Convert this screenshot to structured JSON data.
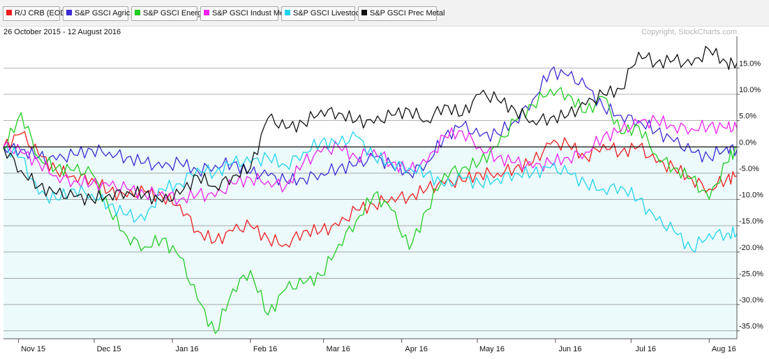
{
  "legend": [
    {
      "label": "R/J CRB (EOD)",
      "color": "#ee1c1c"
    },
    {
      "label": "S&P GSCI Agric",
      "color": "#3a2ad6"
    },
    {
      "label": "S&P GSCI Energy",
      "color": "#22cc22"
    },
    {
      "label": "S&P GSCI Indust Met",
      "color": "#ee22ee"
    },
    {
      "label": "S&P GSCI Livestock",
      "color": "#22d4ee"
    },
    {
      "label": "S&P GSCI Prec Metal",
      "color": "#111111"
    }
  ],
  "header": {
    "date_range": "26 October 2015 - 12 August 2016",
    "copyright": "Copyright, StockCharts.com"
  },
  "chart_data": {
    "type": "line",
    "title": "",
    "xlabel": "",
    "ylabel": "",
    "x_start": "2015-10-26",
    "x_end": "2016-08-12",
    "ylim": [
      -36.5,
      20.5
    ],
    "y_ticks": [
      "15.0%",
      "10.0%",
      "5.0%",
      "0.0%",
      "-5.0%",
      "-10.0%",
      "-15.0%",
      "-20.0%",
      "-25.0%",
      "-30.0%",
      "-35.0%"
    ],
    "x_tick_labels": [
      "Nov 15",
      "Dec 15",
      "Jan 16",
      "Feb 16",
      "Mar 16",
      "Apr 16",
      "May 16",
      "Jun 16",
      "Jul 16",
      "Aug 16"
    ],
    "grid": true,
    "zero_line": true,
    "negative_fill_color": "#ecfafc",
    "series": [
      {
        "name": "R/J CRB (EOD)",
        "color": "#ee1c1c",
        "x": [
          "2015-10-26",
          "2015-11-02",
          "2015-11-09",
          "2015-11-16",
          "2015-11-23",
          "2015-11-30",
          "2015-12-07",
          "2015-12-14",
          "2015-12-21",
          "2015-12-28",
          "2016-01-04",
          "2016-01-11",
          "2016-01-18",
          "2016-01-25",
          "2016-02-01",
          "2016-02-08",
          "2016-02-15",
          "2016-02-22",
          "2016-02-29",
          "2016-03-07",
          "2016-03-14",
          "2016-03-21",
          "2016-03-28",
          "2016-04-04",
          "2016-04-11",
          "2016-04-18",
          "2016-04-25",
          "2016-05-02",
          "2016-05-09",
          "2016-05-16",
          "2016-05-23",
          "2016-05-30",
          "2016-06-06",
          "2016-06-13",
          "2016-06-20",
          "2016-06-27",
          "2016-07-04",
          "2016-07-11",
          "2016-07-18",
          "2016-07-25",
          "2016-08-01",
          "2016-08-08",
          "2016-08-12"
        ],
        "values": [
          0.0,
          2.5,
          -1.5,
          -4.5,
          -5.5,
          -6.0,
          -8.5,
          -9.5,
          -8.5,
          -9.5,
          -11.0,
          -16.0,
          -18.0,
          -16.0,
          -15.0,
          -17.5,
          -18.5,
          -16.0,
          -16.0,
          -15.0,
          -12.0,
          -11.0,
          -9.5,
          -9.5,
          -8.0,
          -7.0,
          -6.5,
          -5.0,
          -5.0,
          -4.0,
          -3.0,
          0.5,
          0.5,
          -2.0,
          0.5,
          -1.0,
          0.0,
          -3.0,
          -4.0,
          -6.0,
          -8.0,
          -6.0,
          -5.5
        ]
      },
      {
        "name": "S&P GSCI Agric",
        "color": "#3a2ad6",
        "x": [
          "2015-10-26",
          "2015-11-02",
          "2015-11-09",
          "2015-11-16",
          "2015-11-23",
          "2015-11-30",
          "2015-12-07",
          "2015-12-14",
          "2015-12-21",
          "2015-12-28",
          "2016-01-04",
          "2016-01-11",
          "2016-01-18",
          "2016-01-25",
          "2016-02-01",
          "2016-02-08",
          "2016-02-15",
          "2016-02-22",
          "2016-02-29",
          "2016-03-07",
          "2016-03-14",
          "2016-03-21",
          "2016-03-28",
          "2016-04-04",
          "2016-04-11",
          "2016-04-18",
          "2016-04-25",
          "2016-05-02",
          "2016-05-09",
          "2016-05-16",
          "2016-05-23",
          "2016-05-30",
          "2016-06-06",
          "2016-06-13",
          "2016-06-20",
          "2016-06-27",
          "2016-07-04",
          "2016-07-11",
          "2016-07-18",
          "2016-07-25",
          "2016-08-01",
          "2016-08-08",
          "2016-08-12"
        ],
        "values": [
          0.0,
          -0.5,
          -2.0,
          -2.5,
          -1.5,
          -0.5,
          -1.0,
          -2.0,
          -3.0,
          -4.0,
          -3.0,
          -4.5,
          -3.5,
          -3.0,
          -5.0,
          -5.5,
          -6.5,
          -6.0,
          -5.0,
          -4.0,
          -3.5,
          -2.0,
          -3.5,
          -5.0,
          -3.0,
          2.0,
          4.0,
          2.0,
          2.5,
          5.0,
          9.0,
          14.5,
          13.5,
          11.5,
          7.5,
          6.0,
          5.0,
          3.0,
          1.0,
          -1.0,
          -2.0,
          0.0,
          -0.5
        ]
      },
      {
        "name": "S&P GSCI Energy",
        "color": "#22cc22",
        "x": [
          "2015-10-26",
          "2015-11-02",
          "2015-11-09",
          "2015-11-16",
          "2015-11-23",
          "2015-11-30",
          "2015-12-07",
          "2015-12-14",
          "2015-12-21",
          "2015-12-28",
          "2016-01-04",
          "2016-01-11",
          "2016-01-18",
          "2016-01-25",
          "2016-02-01",
          "2016-02-08",
          "2016-02-15",
          "2016-02-22",
          "2016-02-29",
          "2016-03-07",
          "2016-03-14",
          "2016-03-21",
          "2016-03-28",
          "2016-04-04",
          "2016-04-11",
          "2016-04-18",
          "2016-04-25",
          "2016-05-02",
          "2016-05-09",
          "2016-05-16",
          "2016-05-23",
          "2016-05-30",
          "2016-06-06",
          "2016-06-13",
          "2016-06-20",
          "2016-06-27",
          "2016-07-04",
          "2016-07-11",
          "2016-07-18",
          "2016-07-25",
          "2016-08-01",
          "2016-08-08",
          "2016-08-12"
        ],
        "values": [
          -0.5,
          6.5,
          -2.0,
          -4.0,
          -4.5,
          -5.0,
          -12.0,
          -17.0,
          -19.0,
          -17.5,
          -21.0,
          -29.0,
          -35.5,
          -27.0,
          -23.5,
          -32.0,
          -27.0,
          -26.0,
          -24.5,
          -18.5,
          -14.0,
          -9.0,
          -12.0,
          -19.5,
          -12.0,
          -5.0,
          -4.0,
          -3.0,
          0.0,
          5.0,
          8.0,
          11.0,
          10.0,
          6.5,
          9.5,
          2.5,
          4.0,
          -1.5,
          -4.0,
          -6.0,
          -10.0,
          -3.0,
          0.0
        ]
      },
      {
        "name": "S&P GSCI Indust Met",
        "color": "#ee22ee",
        "x": [
          "2015-10-26",
          "2015-11-02",
          "2015-11-09",
          "2015-11-16",
          "2015-11-23",
          "2015-11-30",
          "2015-12-07",
          "2015-12-14",
          "2015-12-21",
          "2015-12-28",
          "2016-01-04",
          "2016-01-11",
          "2016-01-18",
          "2016-01-25",
          "2016-02-01",
          "2016-02-08",
          "2016-02-15",
          "2016-02-22",
          "2016-02-29",
          "2016-03-07",
          "2016-03-14",
          "2016-03-21",
          "2016-03-28",
          "2016-04-04",
          "2016-04-11",
          "2016-04-18",
          "2016-04-25",
          "2016-05-02",
          "2016-05-09",
          "2016-05-16",
          "2016-05-23",
          "2016-05-30",
          "2016-06-06",
          "2016-06-13",
          "2016-06-20",
          "2016-06-27",
          "2016-07-04",
          "2016-07-11",
          "2016-07-18",
          "2016-07-25",
          "2016-08-01",
          "2016-08-08",
          "2016-08-12"
        ],
        "values": [
          0.0,
          -1.0,
          -3.0,
          -5.5,
          -6.5,
          -7.0,
          -7.5,
          -8.0,
          -9.0,
          -8.5,
          -10.0,
          -9.0,
          -9.5,
          -7.0,
          -6.0,
          -6.5,
          -7.5,
          -3.0,
          -1.0,
          0.0,
          -2.0,
          -0.5,
          -3.0,
          -4.5,
          -3.0,
          2.0,
          3.0,
          0.0,
          -2.0,
          -3.0,
          -4.0,
          -3.0,
          -2.0,
          -1.0,
          2.0,
          3.0,
          4.5,
          5.0,
          4.0,
          3.5,
          4.0,
          3.5,
          3.5
        ]
      },
      {
        "name": "S&P GSCI Livestock",
        "color": "#22d4ee",
        "x": [
          "2015-10-26",
          "2015-11-02",
          "2015-11-09",
          "2015-11-16",
          "2015-11-23",
          "2015-11-30",
          "2015-12-07",
          "2015-12-14",
          "2015-12-21",
          "2015-12-28",
          "2016-01-04",
          "2016-01-11",
          "2016-01-18",
          "2016-01-25",
          "2016-02-01",
          "2016-02-08",
          "2016-02-15",
          "2016-02-22",
          "2016-02-29",
          "2016-03-07",
          "2016-03-14",
          "2016-03-21",
          "2016-03-28",
          "2016-04-04",
          "2016-04-11",
          "2016-04-18",
          "2016-04-25",
          "2016-05-02",
          "2016-05-09",
          "2016-05-16",
          "2016-05-23",
          "2016-05-30",
          "2016-06-06",
          "2016-06-13",
          "2016-06-20",
          "2016-06-27",
          "2016-07-04",
          "2016-07-11",
          "2016-07-18",
          "2016-07-25",
          "2016-08-01",
          "2016-08-08",
          "2016-08-12"
        ],
        "values": [
          0.0,
          -2.0,
          -9.0,
          -10.0,
          -8.0,
          -9.0,
          -11.0,
          -13.0,
          -14.0,
          -8.0,
          -7.0,
          -4.0,
          -5.0,
          -3.0,
          -3.0,
          -2.0,
          -3.5,
          -1.0,
          1.0,
          0.5,
          2.0,
          -2.0,
          -3.0,
          -4.0,
          -5.0,
          -7.5,
          -6.0,
          -7.0,
          -6.0,
          -5.0,
          -5.0,
          -4.0,
          -5.0,
          -7.0,
          -8.0,
          -7.5,
          -10.0,
          -14.0,
          -16.0,
          -19.5,
          -16.5,
          -16.5,
          -16.5
        ]
      },
      {
        "name": "S&P GSCI Prec Metal",
        "color": "#111111",
        "x": [
          "2015-10-26",
          "2015-11-02",
          "2015-11-09",
          "2015-11-16",
          "2015-11-23",
          "2015-11-30",
          "2015-12-07",
          "2015-12-14",
          "2015-12-21",
          "2015-12-28",
          "2016-01-04",
          "2016-01-11",
          "2016-01-18",
          "2016-01-25",
          "2016-02-01",
          "2016-02-08",
          "2016-02-15",
          "2016-02-22",
          "2016-02-29",
          "2016-03-07",
          "2016-03-14",
          "2016-03-21",
          "2016-03-28",
          "2016-04-04",
          "2016-04-11",
          "2016-04-18",
          "2016-04-25",
          "2016-05-02",
          "2016-05-09",
          "2016-05-16",
          "2016-05-23",
          "2016-05-30",
          "2016-06-06",
          "2016-06-13",
          "2016-06-20",
          "2016-06-27",
          "2016-07-04",
          "2016-07-11",
          "2016-07-18",
          "2016-07-25",
          "2016-08-01",
          "2016-08-08",
          "2016-08-12"
        ],
        "values": [
          0.0,
          -4.5,
          -7.5,
          -9.0,
          -9.5,
          -10.0,
          -9.0,
          -8.5,
          -9.0,
          -10.5,
          -9.0,
          -5.5,
          -7.5,
          -5.5,
          -4.0,
          5.5,
          3.5,
          4.5,
          7.0,
          6.5,
          5.0,
          4.5,
          6.0,
          7.0,
          5.0,
          8.0,
          6.0,
          10.0,
          9.0,
          7.0,
          5.0,
          5.5,
          6.0,
          8.0,
          10.0,
          11.0,
          18.0,
          16.0,
          16.5,
          15.5,
          18.5,
          16.0,
          16.0
        ]
      }
    ]
  }
}
